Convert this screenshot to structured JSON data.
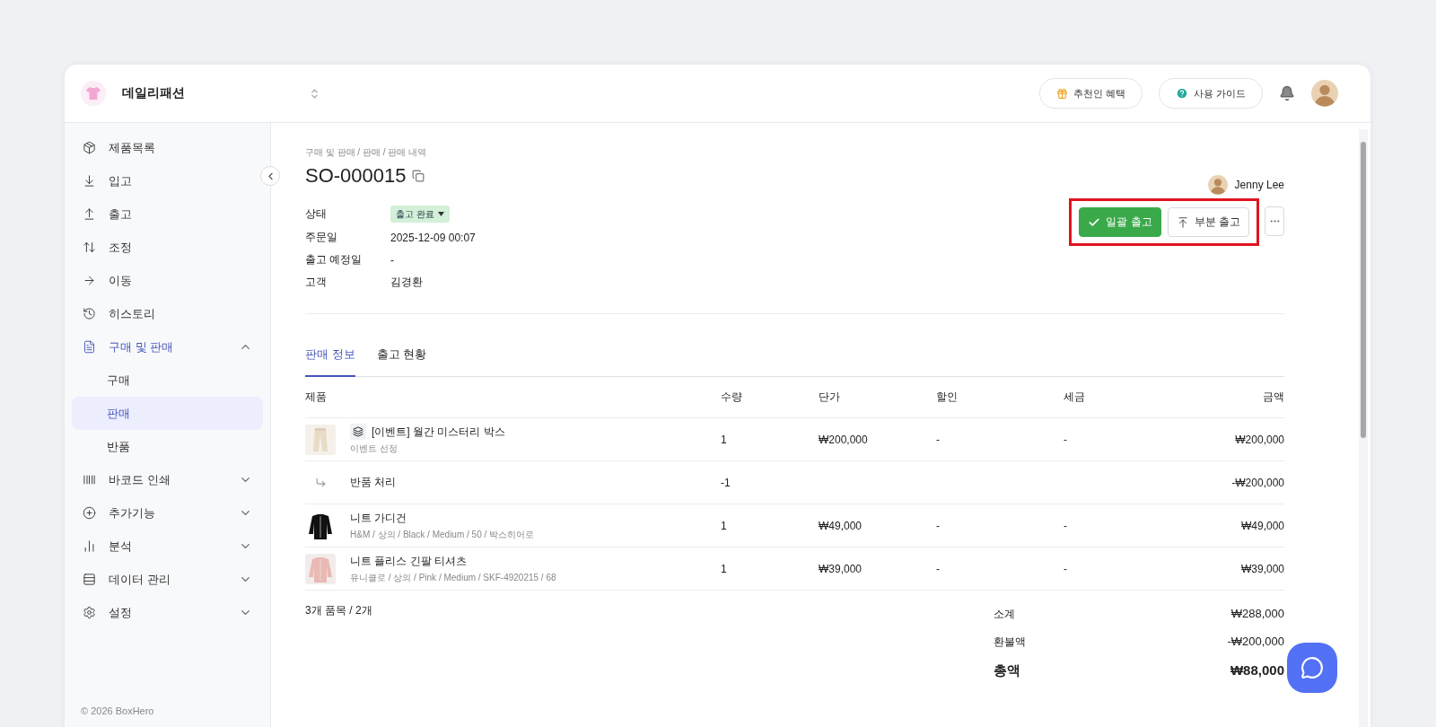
{
  "workspace": {
    "name": "데일리패션"
  },
  "top_buttons": [
    {
      "label": "추천인 혜택",
      "kind": "gift"
    },
    {
      "label": "사용 가이드",
      "kind": "help"
    }
  ],
  "sidebar": {
    "items": [
      {
        "label": "제품목록",
        "selected": false
      },
      {
        "label": "입고",
        "selected": false
      },
      {
        "label": "출고",
        "selected": false
      },
      {
        "label": "조정",
        "selected": false
      },
      {
        "label": "이동",
        "selected": false
      },
      {
        "label": "히스토리",
        "selected": false
      },
      {
        "label": "구매 및 판매",
        "selected": true,
        "expanded": true,
        "children": [
          {
            "label": "구매",
            "selected": false
          },
          {
            "label": "판매",
            "selected": true
          },
          {
            "label": "반품",
            "selected": false
          }
        ]
      },
      {
        "label": "바코드 인쇄",
        "selected": false,
        "expanded": false
      },
      {
        "label": "추가기능",
        "selected": false,
        "expanded": false
      },
      {
        "label": "분석",
        "selected": false,
        "expanded": false
      },
      {
        "label": "데이터 관리",
        "selected": false,
        "expanded": false
      },
      {
        "label": "설정",
        "selected": false,
        "expanded": false
      }
    ],
    "footer": "© 2026 BoxHero"
  },
  "breadcrumb": "구매 및 판매 / 판매 / 판매 내역",
  "title": "SO-000015",
  "owner": "Jenny Lee",
  "fields": [
    {
      "label": "상태",
      "value": "출고 완료",
      "kind": "status"
    },
    {
      "label": "주문일",
      "value": "2025-12-09 00:07",
      "kind": "text"
    },
    {
      "label": "출고 예정일",
      "value": "-",
      "kind": "text"
    },
    {
      "label": "고객",
      "value": "김경환",
      "kind": "text"
    }
  ],
  "actions": {
    "highlighted": true,
    "buttons": [
      {
        "label": "일괄 출고",
        "kind": "primary"
      },
      {
        "label": "부분 출고",
        "kind": "secondary"
      }
    ]
  },
  "tabs": [
    {
      "label": "판매 정보",
      "selected": true
    },
    {
      "label": "출고 현황",
      "selected": false
    }
  ],
  "table": {
    "columns": [
      "제품",
      "수량",
      "단가",
      "할인",
      "세금",
      "금액"
    ],
    "rows": [
      {
        "kind": "product",
        "bundle": true,
        "name": "[이벤트] 월간 미스터리 박스",
        "detail": "이벤트 선정",
        "qty": "1",
        "price": "₩200,000",
        "discount": "-",
        "tax": "-",
        "amount": "₩200,000"
      },
      {
        "kind": "return",
        "name": "반품 처리",
        "qty": "-1",
        "amount": "-₩200,000"
      },
      {
        "kind": "product",
        "bundle": false,
        "name": "니트 가디건",
        "detail": "H&M / 상의 / Black / Medium / 50 / 박스히어로",
        "qty": "1",
        "price": "₩49,000",
        "discount": "-",
        "tax": "-",
        "amount": "₩49,000"
      },
      {
        "kind": "product",
        "bundle": false,
        "name": "니트 플리스 긴팔 티셔츠",
        "detail": "유니클로 / 상의 / Pink / Medium / SKF-4920215 / 68",
        "qty": "1",
        "price": "₩39,000",
        "discount": "-",
        "tax": "-",
        "amount": "₩39,000"
      }
    ]
  },
  "summary": {
    "count": "3개 품목 / 2개",
    "lines": [
      {
        "label": "소계",
        "value": "₩288,000",
        "kind": "normal"
      },
      {
        "label": "환불액",
        "value": "-₩200,000",
        "kind": "normal"
      },
      {
        "label": "총액",
        "value": "₩88,000",
        "kind": "total"
      }
    ]
  }
}
